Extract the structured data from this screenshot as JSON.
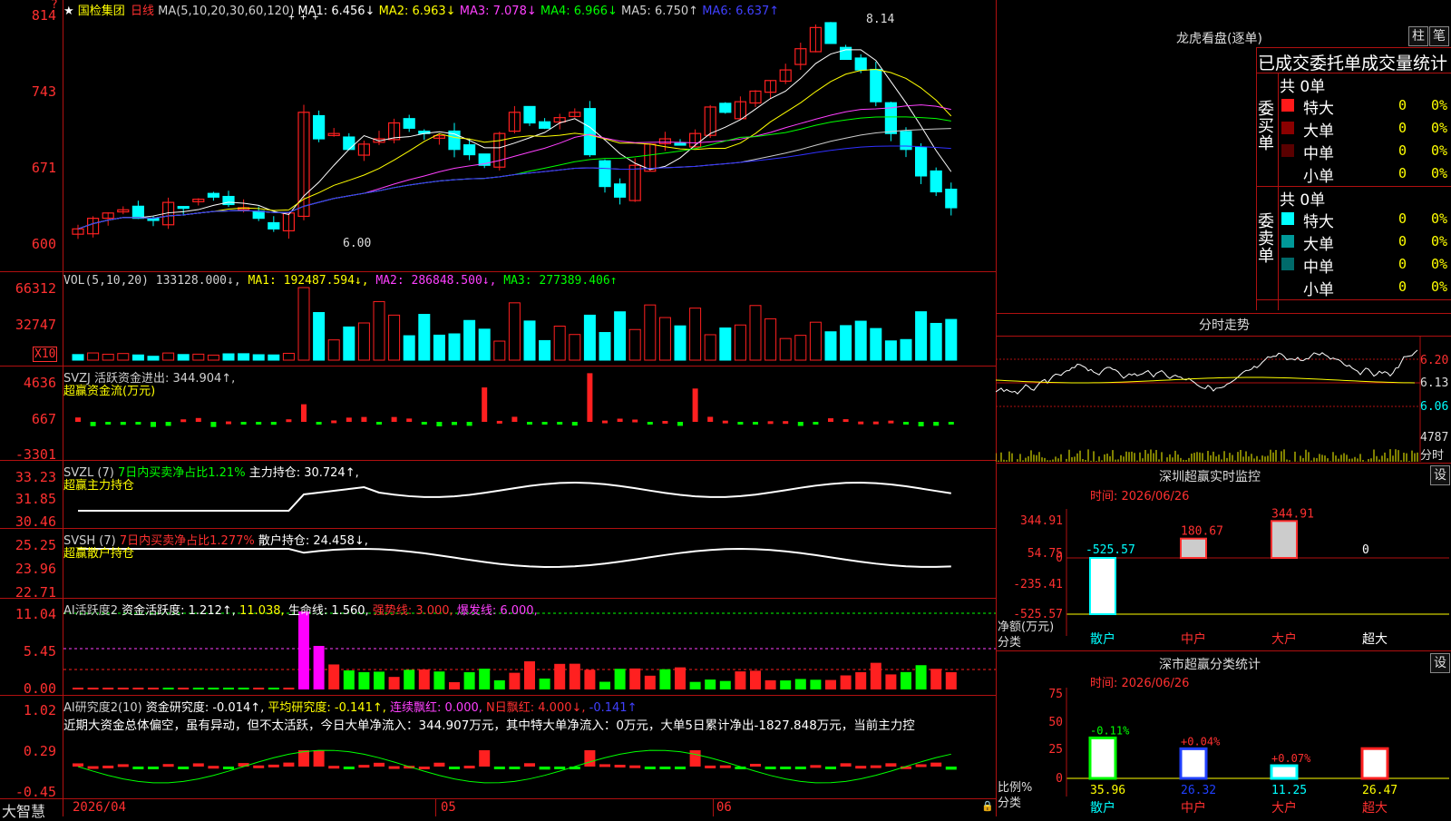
{
  "stock": {
    "star": "★",
    "question": "?",
    "name": "国检集团",
    "period": "日线",
    "ma_label": "MA(5,10,20,30,60,120)",
    "ma1": "MA1: 6.456↓",
    "ma2": "MA2: 6.963↓",
    "ma3": "MA3: 7.078↓",
    "ma4": "MA4: 6.966↓",
    "ma5": "MA5: 6.750↑",
    "ma6": "MA6: 6.637↑",
    "high_mark": "8.14",
    "low_mark": "6.00",
    "y_ticks": [
      "814",
      "743",
      "671",
      "600"
    ],
    "plus_marks": "+ + +"
  },
  "vol": {
    "label": "VOL(5,10,20) 133128.000↓,",
    "ma1": "MA1: 192487.594↓,",
    "ma2": "MA2: 286848.500↓,",
    "ma3": "MA3: 277389.406↑",
    "y_ticks": [
      "66312",
      "32747"
    ],
    "unit": "X10"
  },
  "svzj": {
    "label": "SVZJ  活跃资金进出: 344.904↑,",
    "sub": "超赢资金流(万元)",
    "y_ticks": [
      "4636",
      "667",
      "-3301"
    ]
  },
  "svzl": {
    "label1": "SVZL (7)",
    "label2": "7日内买卖净占比1.21%",
    "label3": "主力持仓: 30.724↑,",
    "sub": "超赢主力持仓",
    "y_ticks": [
      "33.23",
      "31.85",
      "30.46"
    ]
  },
  "svsh": {
    "label1": "SVSH (7)",
    "label2": "7日内买卖净占比1.277%",
    "label3": "散户持仓: 24.458↓,",
    "sub": "超赢散户持仓",
    "y_ticks": [
      "25.25",
      "23.96",
      "22.71"
    ]
  },
  "ai1": {
    "label1": "AI活跃度2",
    "label2": "资金活跃度: 1.212↑,",
    "label3": "11.038,",
    "label4": "生命线: 1.560,",
    "label5": "强势线: 3.000,",
    "label6": "爆发线: 6.000,",
    "y_ticks": [
      "11.04",
      "5.45",
      "0.00"
    ]
  },
  "ai2": {
    "label1": "AI研究度2(10)",
    "label2": "资金研究度: -0.014↑,",
    "label3": "平均研究度: -0.141↑,",
    "label4": "连续飘红: 0.000,",
    "label5": "N日飘红: 4.000↓,",
    "label6": "-0.141↑",
    "comment": "近期大资金总体偏空，虽有异动，但不太活跃，今日大单净流入：344.907万元，其中特大单净流入：0万元，大单5日累计净出-1827.848万元，当前主力控",
    "y_ticks": [
      "1.02",
      "0.29",
      "-0.45"
    ]
  },
  "xaxis": {
    "brand": "大智慧",
    "date": "2026/04",
    "m5": "05",
    "m6": "06"
  },
  "dragon": {
    "title": "龙虎看盘(逐单)",
    "btn1": "柱",
    "btn2": "笔",
    "subtitle": "已成交委托单成交量统计",
    "buy_label": "委买单",
    "sell_label": "委卖单",
    "buy_total": "共 0单",
    "sell_total": "共 0单",
    "buy_rows": [
      {
        "name": "特大",
        "count": "0",
        "pct": "0%",
        "color": "#ff1a1a"
      },
      {
        "name": "大单",
        "count": "0",
        "pct": "0%",
        "color": "#8b0000"
      },
      {
        "name": "中单",
        "count": "0",
        "pct": "0%",
        "color": "#5a0000"
      },
      {
        "name": "小单",
        "count": "0",
        "pct": "0%",
        "color": ""
      }
    ],
    "sell_rows": [
      {
        "name": "特大",
        "count": "0",
        "pct": "0%",
        "color": "#00ffff"
      },
      {
        "name": "大单",
        "count": "0",
        "pct": "0%",
        "color": "#009999"
      },
      {
        "name": "中单",
        "count": "0",
        "pct": "0%",
        "color": "#006a6a"
      },
      {
        "name": "小单",
        "count": "0",
        "pct": "0%",
        "color": ""
      }
    ]
  },
  "fenshi": {
    "title": "分时走势",
    "p1": "6.20",
    "p2": "6.13",
    "p3": "6.06",
    "vol": "4787",
    "vol_label": "分时"
  },
  "sz_monitor": {
    "title": "深圳超赢实时监控",
    "btn": "设",
    "time": "时间: 2026/06/26",
    "y_ticks": [
      "344.91",
      "54.75",
      "0",
      "-235.41",
      "-525.57"
    ],
    "values": [
      {
        "cat": "散户",
        "value": "-525.57"
      },
      {
        "cat": "中户",
        "value": "180.67"
      },
      {
        "cat": "大户",
        "value": "344.91"
      },
      {
        "cat": "超大",
        "value": "0"
      }
    ],
    "ylabel": "净额(万元)",
    "xlabel": "分类"
  },
  "sz_class": {
    "title": "深市超赢分类统计",
    "btn": "设",
    "time": "时间: 2026/06/26",
    "y_ticks": [
      "75",
      "50",
      "25",
      "0"
    ],
    "bars": [
      {
        "cat": "散户",
        "pct": "35.96",
        "chg": "-0.11%"
      },
      {
        "cat": "中户",
        "pct": "26.32",
        "chg": "+0.04%"
      },
      {
        "cat": "大户",
        "pct": "11.25",
        "chg": "+0.07%"
      },
      {
        "cat": "超大",
        "pct": "26.47",
        "chg": ""
      }
    ],
    "ylabel": "比例%",
    "xlabel": "分类"
  },
  "colors": {
    "up": "#ff2020",
    "down": "#00ffff",
    "grid": "#b01010"
  }
}
